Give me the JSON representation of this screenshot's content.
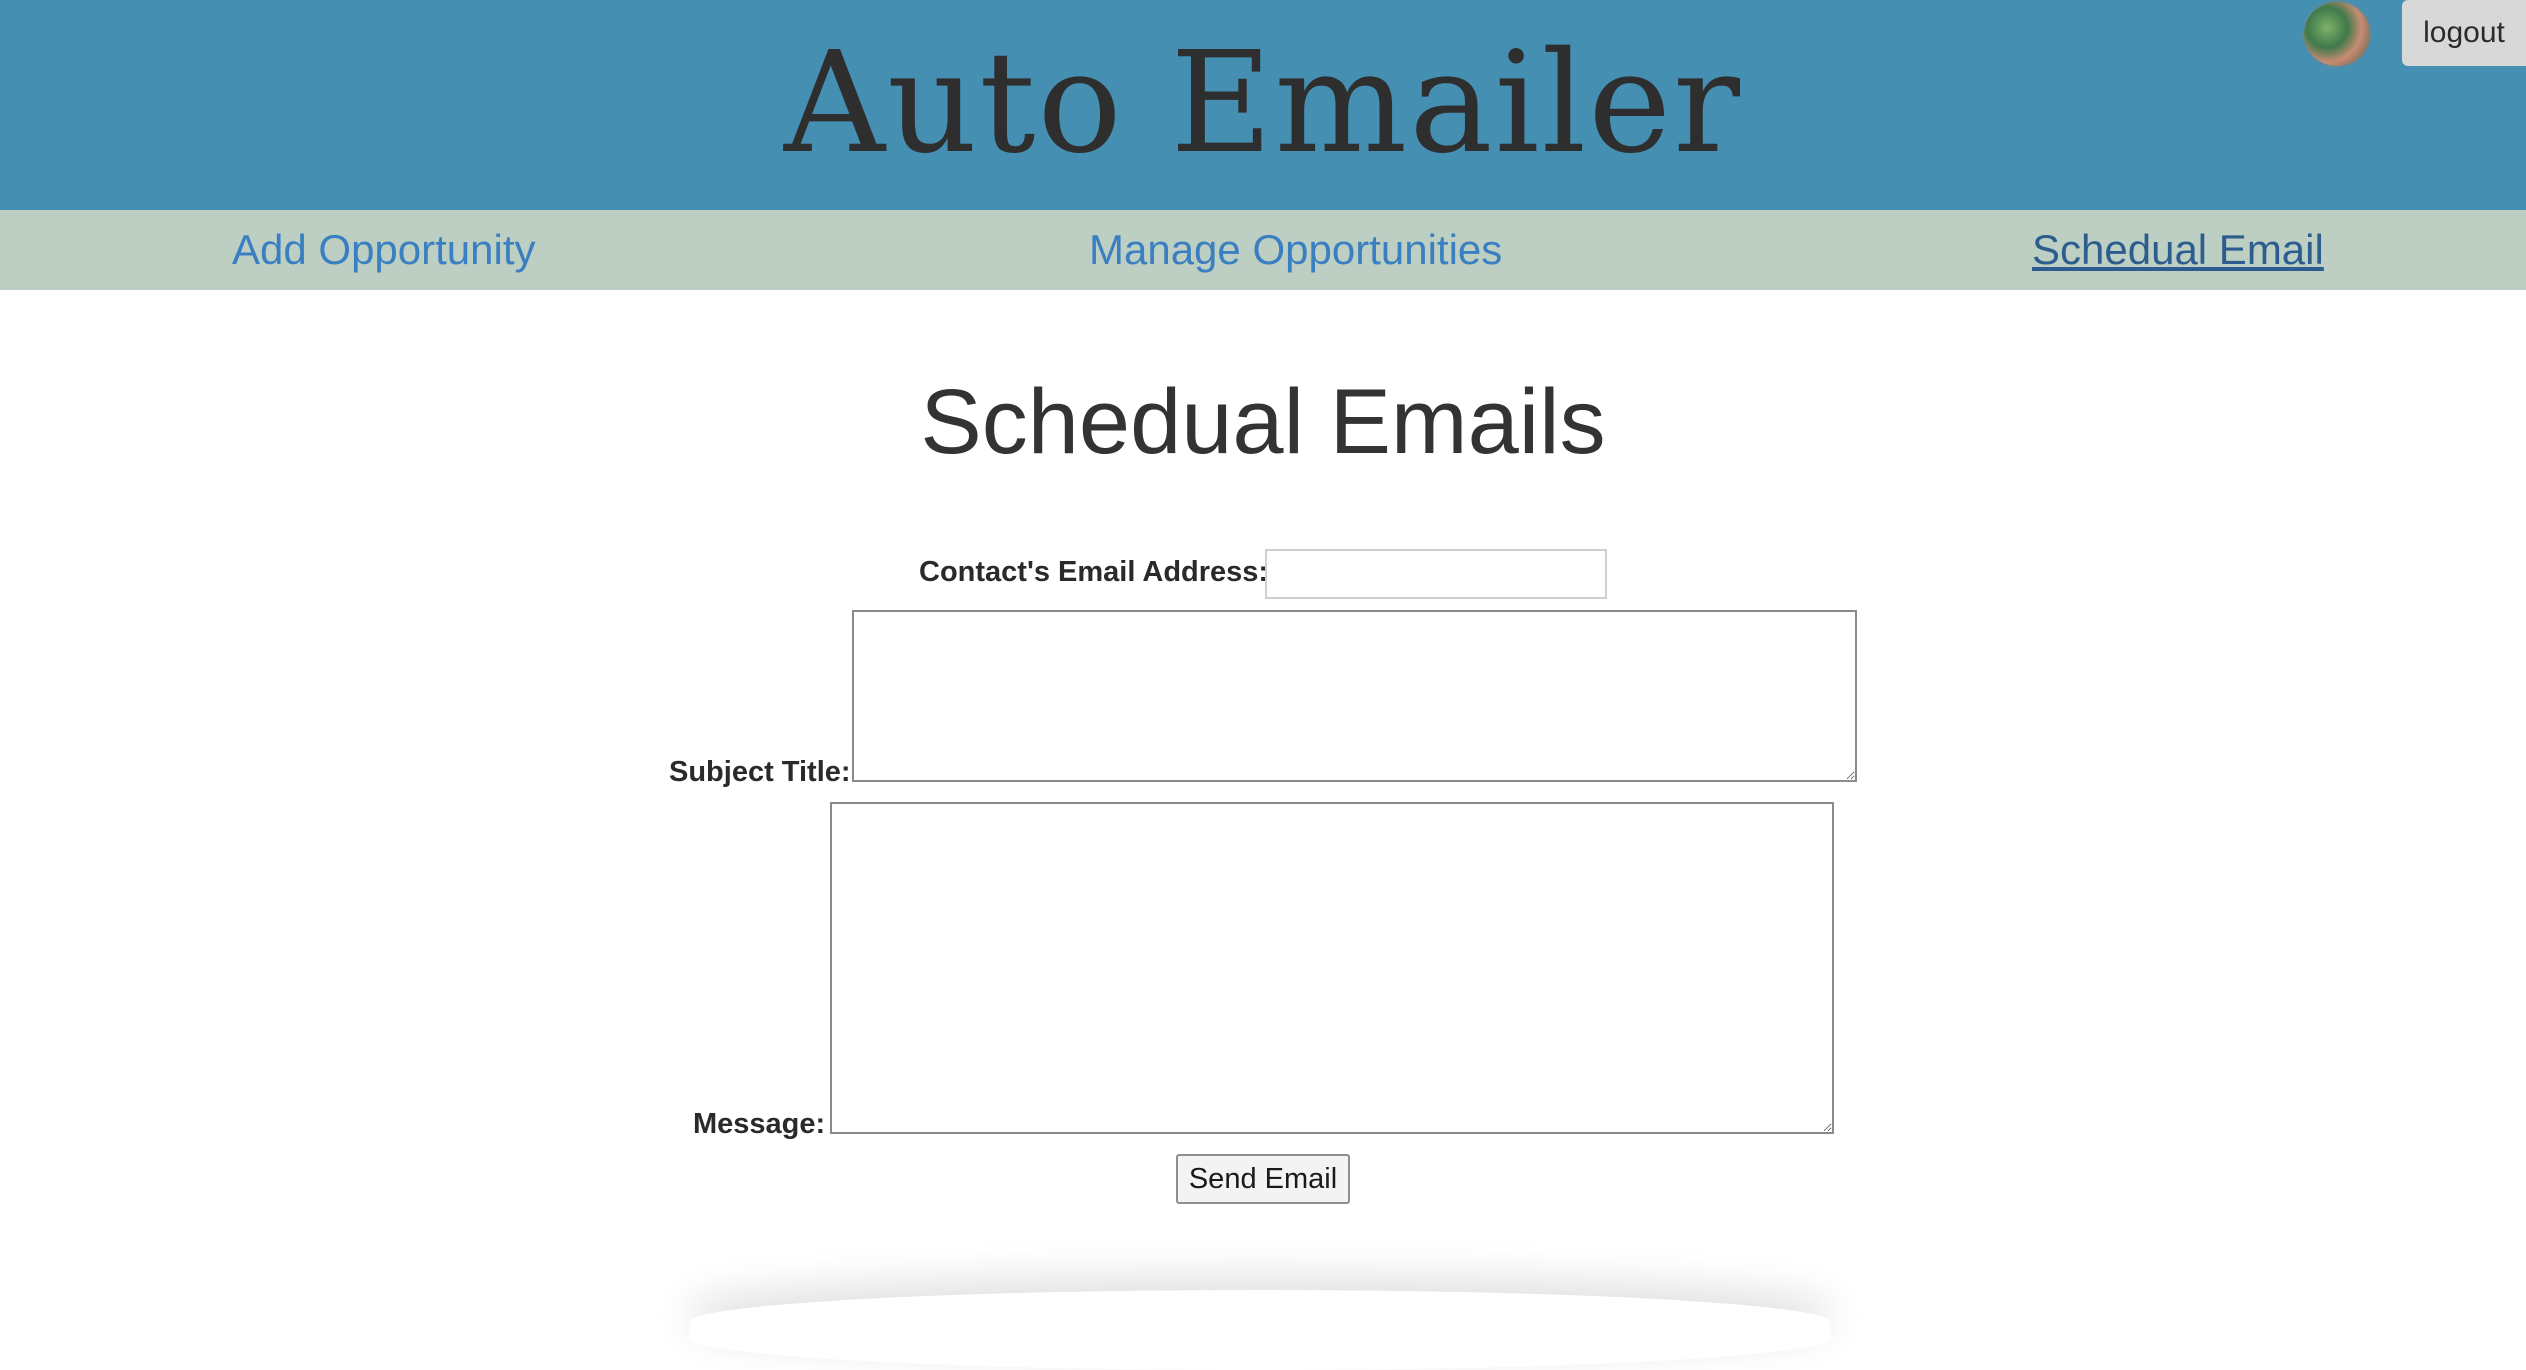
{
  "header": {
    "app_title": "Auto Emailer",
    "logout_label": "logout"
  },
  "nav": {
    "items": [
      {
        "label": "Add Opportunity",
        "active": false
      },
      {
        "label": "Manage Opportunities",
        "active": false
      },
      {
        "label": "Schedual Email",
        "active": true
      }
    ]
  },
  "main": {
    "title": "Schedual Emails",
    "form": {
      "email_label": "Contact's Email Address:",
      "email_value": "",
      "subject_label": "Subject Title:",
      "subject_value": "",
      "message_label": "Message:",
      "message_value": "",
      "send_label": "Send Email"
    }
  },
  "colors": {
    "header_bg": "#448fb2",
    "nav_bg": "#bccfc2",
    "link": "#3a7fc1",
    "active_link": "#2c5d8e"
  },
  "icons": {
    "avatar": "user-avatar-photo"
  }
}
